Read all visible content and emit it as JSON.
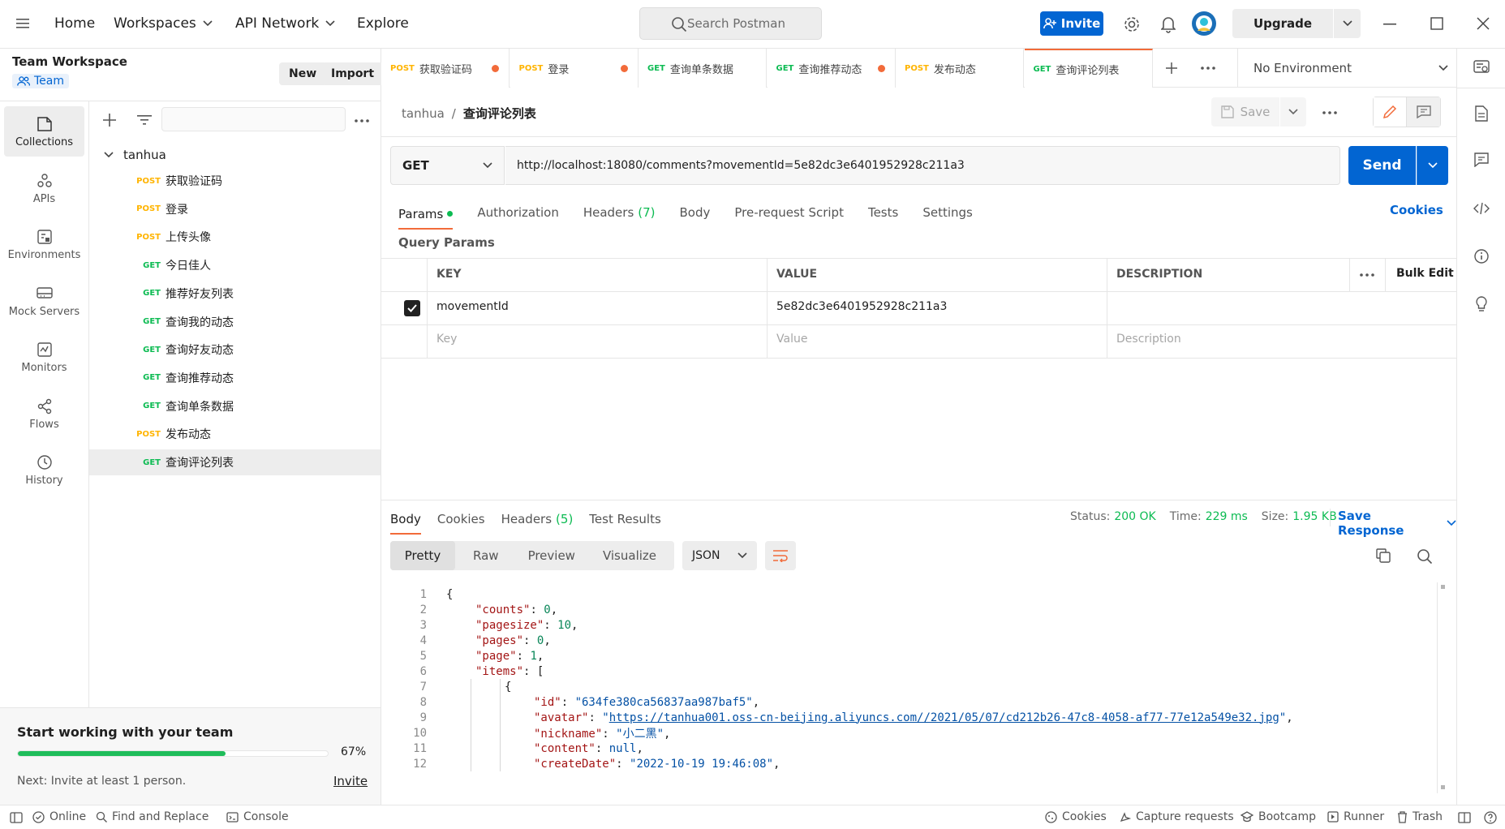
{
  "topbar": {
    "home": "Home",
    "workspaces": "Workspaces",
    "api_network": "API Network",
    "explore": "Explore",
    "search_placeholder": "Search Postman",
    "invite": "Invite",
    "upgrade": "Upgrade"
  },
  "workspace": {
    "name": "Team Workspace",
    "team": "Team",
    "new": "New",
    "import": "Import"
  },
  "sidebar_nav": [
    {
      "label": "Collections",
      "icon": "collections-icon"
    },
    {
      "label": "APIs",
      "icon": "apis-icon"
    },
    {
      "label": "Environments",
      "icon": "environments-icon"
    },
    {
      "label": "Mock Servers",
      "icon": "mock-servers-icon"
    },
    {
      "label": "Monitors",
      "icon": "monitors-icon"
    },
    {
      "label": "Flows",
      "icon": "flows-icon"
    },
    {
      "label": "History",
      "icon": "history-icon"
    }
  ],
  "collection": {
    "name": "tanhua",
    "items": [
      {
        "method": "POST",
        "name": "获取验证码"
      },
      {
        "method": "POST",
        "name": "登录"
      },
      {
        "method": "POST",
        "name": "上传头像"
      },
      {
        "method": "GET",
        "name": "今日佳人"
      },
      {
        "method": "GET",
        "name": "推荐好友列表"
      },
      {
        "method": "GET",
        "name": "查询我的动态"
      },
      {
        "method": "GET",
        "name": "查询好友动态"
      },
      {
        "method": "GET",
        "name": "查询推荐动态"
      },
      {
        "method": "GET",
        "name": "查询单条数据"
      },
      {
        "method": "POST",
        "name": "发布动态"
      },
      {
        "method": "GET",
        "name": "查询评论列表"
      }
    ]
  },
  "team_card": {
    "title": "Start working with your team",
    "progress": 67,
    "progress_label": "67%",
    "next": "Next: Invite at least 1 person.",
    "invite": "Invite"
  },
  "tabs": [
    {
      "method": "POST",
      "name": "获取验证码",
      "dirty": true
    },
    {
      "method": "POST",
      "name": "登录",
      "dirty": true
    },
    {
      "method": "GET",
      "name": "查询单条数据",
      "dirty": false
    },
    {
      "method": "GET",
      "name": "查询推荐动态",
      "dirty": true
    },
    {
      "method": "POST",
      "name": "发布动态",
      "dirty": false
    },
    {
      "method": "GET",
      "name": "查询评论列表",
      "dirty": false
    }
  ],
  "environment": "No Environment",
  "request": {
    "breadcrumb_collection": "tanhua",
    "breadcrumb_sep": "/",
    "breadcrumb_name": "查询评论列表",
    "save": "Save",
    "method": "GET",
    "url": "http://localhost:18080/comments?movementId=5e82dc3e6401952928c211a3",
    "send": "Send",
    "tabs": {
      "params": "Params",
      "authorization": "Authorization",
      "headers": "Headers",
      "headers_count": "(7)",
      "body": "Body",
      "prerequest": "Pre-request Script",
      "tests": "Tests",
      "settings": "Settings",
      "cookies": "Cookies"
    },
    "query_params_title": "Query Params",
    "table": {
      "key": "KEY",
      "value": "VALUE",
      "description": "DESCRIPTION",
      "bulk_edit": "Bulk Edit",
      "row_key": "movementId",
      "row_value": "5e82dc3e6401952928c211a3",
      "ph_key": "Key",
      "ph_value": "Value",
      "ph_description": "Description"
    }
  },
  "response": {
    "tabs": {
      "body": "Body",
      "cookies": "Cookies",
      "headers": "Headers",
      "headers_count": "(5)",
      "test_results": "Test Results"
    },
    "status_label": "Status:",
    "status": "200 OK",
    "time_label": "Time:",
    "time": "229 ms",
    "size_label": "Size:",
    "size": "1.95 KB",
    "save_response": "Save Response",
    "views": {
      "pretty": "Pretty",
      "raw": "Raw",
      "preview": "Preview",
      "visualize": "Visualize"
    },
    "format": "JSON"
  },
  "code": [
    {
      "n": "1",
      "indent": 0,
      "parts": [
        [
          "p",
          "{"
        ]
      ]
    },
    {
      "n": "2",
      "indent": 1,
      "parts": [
        [
          "k",
          "\"counts\""
        ],
        [
          "p",
          ": "
        ],
        [
          "num",
          "0"
        ],
        [
          "p",
          ","
        ]
      ]
    },
    {
      "n": "3",
      "indent": 1,
      "parts": [
        [
          "k",
          "\"pagesize\""
        ],
        [
          "p",
          ": "
        ],
        [
          "num",
          "10"
        ],
        [
          "p",
          ","
        ]
      ]
    },
    {
      "n": "4",
      "indent": 1,
      "parts": [
        [
          "k",
          "\"pages\""
        ],
        [
          "p",
          ": "
        ],
        [
          "num",
          "0"
        ],
        [
          "p",
          ","
        ]
      ]
    },
    {
      "n": "5",
      "indent": 1,
      "parts": [
        [
          "k",
          "\"page\""
        ],
        [
          "p",
          ": "
        ],
        [
          "num",
          "1"
        ],
        [
          "p",
          ","
        ]
      ]
    },
    {
      "n": "6",
      "indent": 1,
      "parts": [
        [
          "k",
          "\"items\""
        ],
        [
          "p",
          ": ["
        ]
      ]
    },
    {
      "n": "7",
      "indent": 2,
      "parts": [
        [
          "p",
          "{"
        ]
      ]
    },
    {
      "n": "8",
      "indent": 3,
      "parts": [
        [
          "k",
          "\"id\""
        ],
        [
          "p",
          ": "
        ],
        [
          "s",
          "\"634fe380ca56837aa987baf5\""
        ],
        [
          "p",
          ","
        ]
      ]
    },
    {
      "n": "9",
      "indent": 3,
      "parts": [
        [
          "k",
          "\"avatar\""
        ],
        [
          "p",
          ": "
        ],
        [
          "s",
          "\""
        ],
        [
          "link",
          "https://tanhua001.oss-cn-beijing.aliyuncs.com//2021/05/07/cd212b26-47c8-4058-af77-77e12a549e32.jpg"
        ],
        [
          "s",
          "\""
        ],
        [
          "p",
          ","
        ]
      ]
    },
    {
      "n": "10",
      "indent": 3,
      "parts": [
        [
          "k",
          "\"nickname\""
        ],
        [
          "p",
          ": "
        ],
        [
          "s",
          "\"小二黑\""
        ],
        [
          "p",
          ","
        ]
      ]
    },
    {
      "n": "11",
      "indent": 3,
      "parts": [
        [
          "k",
          "\"content\""
        ],
        [
          "p",
          ": "
        ],
        [
          "kw",
          "null"
        ],
        [
          "p",
          ","
        ]
      ]
    },
    {
      "n": "12",
      "indent": 3,
      "parts": [
        [
          "k",
          "\"createDate\""
        ],
        [
          "p",
          ": "
        ],
        [
          "s",
          "\"2022-10-19 19:46:08\""
        ],
        [
          "p",
          ","
        ]
      ]
    }
  ],
  "statusbar": {
    "online": "Online",
    "find_replace": "Find and Replace",
    "console": "Console",
    "cookies": "Cookies",
    "capture": "Capture requests",
    "bootcamp": "Bootcamp",
    "runner": "Runner",
    "trash": "Trash"
  },
  "colors": {
    "accent": "#f26b3a",
    "primary_blue": "#0265d2",
    "get_green": "#0cbb52",
    "post_orange": "#ffb400",
    "progress_green": "#1fbd5a"
  }
}
